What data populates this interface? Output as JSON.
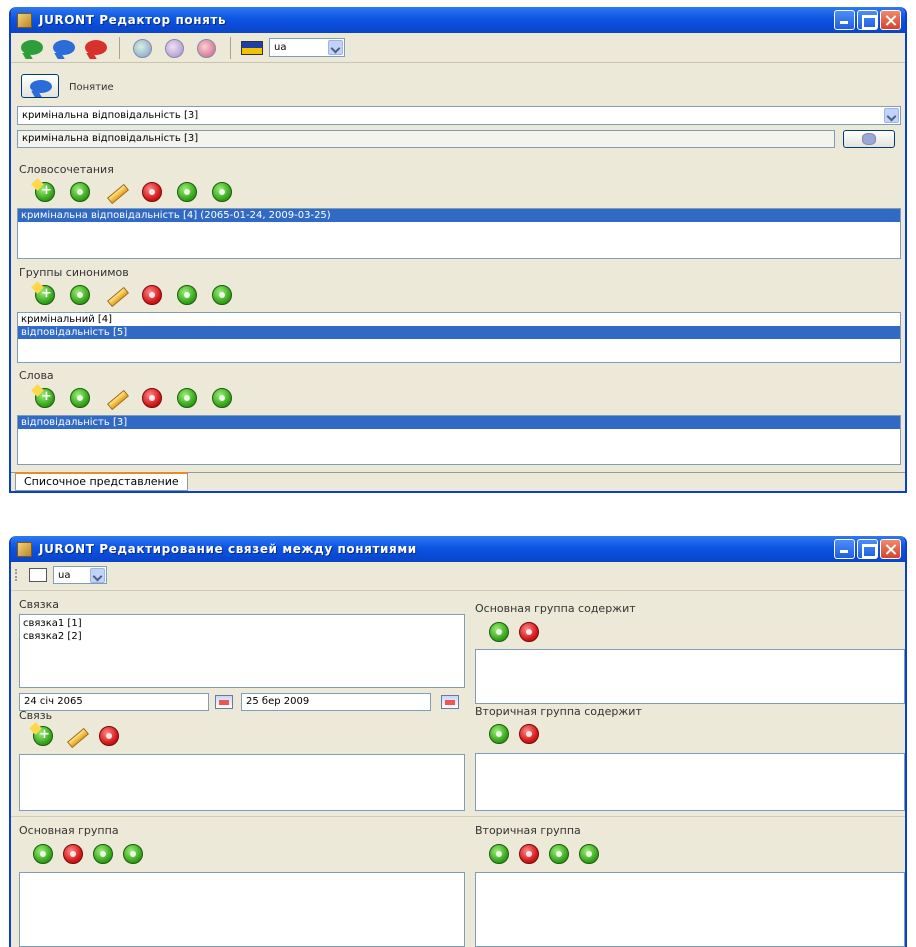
{
  "window1": {
    "title": "JURONT Редактор понять",
    "toolbar": {
      "icons": [
        "bubble-green-icon",
        "bubble-blue-icon",
        "bubble-red-icon",
        "disc-green-icon",
        "disc-purple-icon",
        "disc-red-icon",
        "flag-icon"
      ],
      "language": "ua"
    },
    "concept": {
      "button_label": "Понятие",
      "combo_value": "кримінальна відповідальність [3]",
      "field_value": "кримінальна відповідальність [3]"
    },
    "phrases": {
      "label": "Словосочетания",
      "items": [
        "кримінальна відповідальність [4] (2065-01-24, 2009-03-25)"
      ]
    },
    "synonyms": {
      "label": "Группы синонимов",
      "items": [
        "кримінальний [4]",
        "відповідальність [5]"
      ]
    },
    "words": {
      "label": "Слова",
      "items": [
        "відповідальність [3]"
      ]
    },
    "tab_label": "Списочное представление"
  },
  "window2": {
    "title": "JURONT Редактирование связей между понятиями",
    "language": "ua",
    "link": {
      "label": "Связка",
      "items": [
        "связка1 [1]",
        "связка2 [2]"
      ],
      "date_from": "24 січ 2065",
      "date_to": "25 бер 2009"
    },
    "main_group_contains": {
      "label": "Основная группа содержит"
    },
    "relation": {
      "label": "Связь"
    },
    "secondary_group_contains": {
      "label": "Вторичная группа содержит"
    },
    "main_group": {
      "label": "Основная группа"
    },
    "secondary_group": {
      "label": "Вторичная группа"
    }
  },
  "colors": {
    "titlebar": "#0a49d2",
    "selection": "#316ac5",
    "window_bg": "#ece9d8"
  }
}
